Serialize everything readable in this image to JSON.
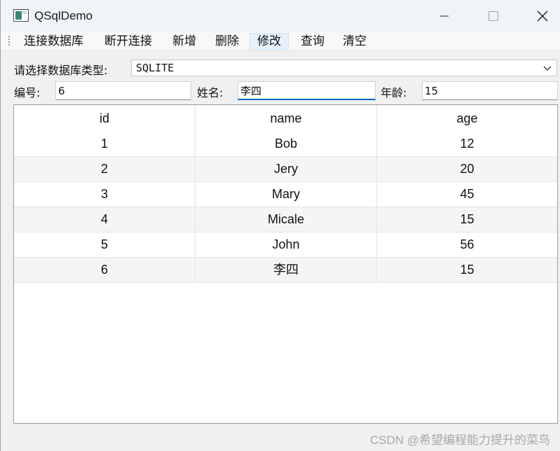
{
  "window": {
    "title": "QSqlDemo"
  },
  "menu": {
    "items": [
      "连接数据库",
      "断开连接",
      "新增",
      "删除",
      "修改",
      "查询",
      "清空"
    ],
    "active_index": 4
  },
  "form": {
    "db_type_label": "请选择数据库类型:",
    "db_type_value": "SQLITE",
    "id_label": "编号:",
    "id_value": "6",
    "name_label": "姓名:",
    "name_value": "李四",
    "age_label": "年龄:",
    "age_value": "15"
  },
  "table": {
    "columns": [
      "id",
      "name",
      "age"
    ],
    "rows": [
      [
        "1",
        "Bob",
        "12"
      ],
      [
        "2",
        "Jery",
        "20"
      ],
      [
        "3",
        "Mary",
        "45"
      ],
      [
        "4",
        "Micale",
        "15"
      ],
      [
        "5",
        "John",
        "56"
      ],
      [
        "6",
        "李四",
        "15"
      ]
    ]
  },
  "watermark": "CSDN @希望编程能力提升的菜鸟",
  "colors": {
    "accent": "#0067c0",
    "titlebar": "#eff4f9",
    "window_bg": "#f0f0f0"
  }
}
